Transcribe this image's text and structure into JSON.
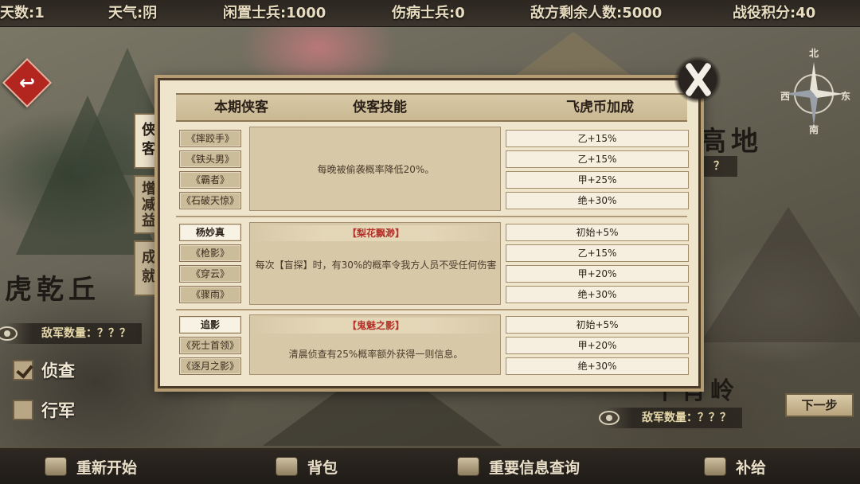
{
  "topbar": {
    "days": "天数:1",
    "weather": "天气:阴",
    "idle_soldiers": "闲置士兵:1000",
    "wounded_soldiers": "伤病士兵:0",
    "enemy_remaining": "敌方剩余人数:5000",
    "battle_points": "战役积分:40"
  },
  "map": {
    "region_left": "虎乾丘",
    "region_right_top": "高地",
    "region_right_bottom": "午肖岭",
    "enemy_count_left": "敌军数量：？？？",
    "enemy_count_right": "敌军数量：？？？",
    "unknown_mark": "？"
  },
  "compass": {
    "north": "北",
    "east": "东",
    "west": "西",
    "south": "南"
  },
  "back_button": {
    "icon": "return-arrow-icon",
    "glyph": "↩"
  },
  "checks": [
    {
      "label": "侦查",
      "checked": true
    },
    {
      "label": "行军",
      "checked": false
    }
  ],
  "next_step": "下一步",
  "bottom": [
    {
      "label": "重新开始",
      "icon": "restart-icon"
    },
    {
      "label": "背包",
      "icon": "backpack-icon"
    },
    {
      "label": "重要信息查询",
      "icon": "info-book-icon"
    },
    {
      "label": "补给",
      "icon": "supply-chest-icon"
    }
  ],
  "modal": {
    "tabs": [
      "侠客",
      "增减益",
      "成就"
    ],
    "headers": {
      "hero": "本期侠客",
      "skill": "侠客技能",
      "bonus": "飞虎币加成"
    },
    "groups": [
      {
        "heroes": [
          "《摔跤手》",
          "《铁头男》",
          "《霸者》",
          "《石破天惊》"
        ],
        "skill_name": "",
        "skill_desc": "每晚被偷袭概率降低20%。",
        "bonuses": [
          "乙+15%",
          "乙+15%",
          "甲+25%",
          "绝+30%"
        ]
      },
      {
        "heroes": [
          "杨妙真",
          "《枪影》",
          "《穿云》",
          "《骤雨》"
        ],
        "skill_name": "【梨花飘渺】",
        "skill_desc": "每次【盲探】时，有30%的概率令我方人员不受任何伤害",
        "bonuses": [
          "初始+5%",
          "乙+15%",
          "甲+20%",
          "绝+30%"
        ]
      },
      {
        "heroes": [
          "追影",
          "《死士首领》",
          "《逐月之影》"
        ],
        "skill_name": "【鬼魅之影】",
        "skill_desc": "清晨侦查有25%概率额外获得一则信息。",
        "bonuses": [
          "初始+5%",
          "甲+20%",
          "绝+30%"
        ]
      }
    ]
  },
  "colors": {
    "accent_red": "#b3322a",
    "panel": "#efe4cc",
    "bar": "#2b2620"
  }
}
